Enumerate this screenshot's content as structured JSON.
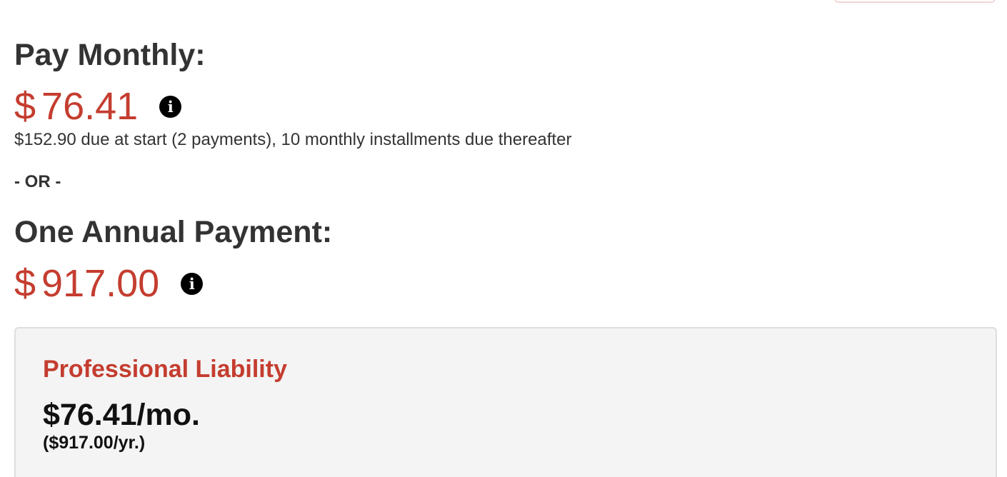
{
  "monthly": {
    "heading": "Pay Monthly:",
    "currency_symbol": "$",
    "amount": "76.41",
    "info_icon": "info-icon",
    "detail": "$152.90 due at start (2 payments), 10 monthly installments due thereafter"
  },
  "separator": "- OR -",
  "annual": {
    "heading": "One Annual Payment:",
    "currency_symbol": "$",
    "amount": "917.00",
    "info_icon": "info-icon"
  },
  "summary_card": {
    "title": "Professional Liability",
    "monthly_price": "$76.41/mo.",
    "yearly_price": "($917.00/yr.)"
  },
  "colors": {
    "accent_red": "#c43d2f",
    "heading_text": "#333333",
    "card_background": "#f4f4f4"
  }
}
